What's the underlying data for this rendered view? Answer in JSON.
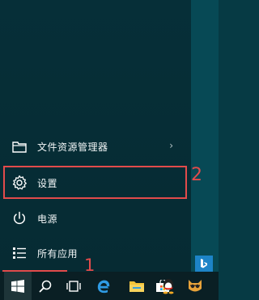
{
  "start_menu": {
    "items": [
      {
        "label": "文件资源管理器",
        "icon": "folder-icon"
      },
      {
        "label": "设置",
        "icon": "gear-icon"
      },
      {
        "label": "电源",
        "icon": "power-icon"
      },
      {
        "label": "所有应用",
        "icon": "list-icon"
      }
    ],
    "chevron": "›"
  },
  "annotations": {
    "one": "1",
    "two": "2"
  },
  "taskbar": {
    "buttons": [
      "windows-logo-icon",
      "search-icon",
      "task-view-icon",
      "edge-icon",
      "file-explorer-icon",
      "store-icon",
      "qq-icon",
      "cat-icon"
    ]
  },
  "colors": {
    "highlight": "#e24b4b",
    "bing": "#1d84c7"
  }
}
